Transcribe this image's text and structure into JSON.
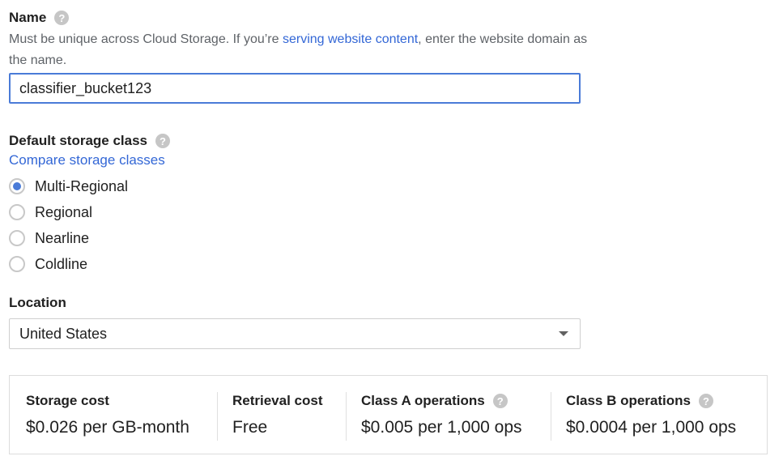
{
  "name": {
    "label": "Name",
    "help_icon": "help-circle-icon",
    "desc_before": "Must be unique across Cloud Storage. If you’re ",
    "desc_link": "serving website content",
    "desc_after": ", enter the website domain as the name.",
    "value": "classifier_bucket123"
  },
  "storage": {
    "label": "Default storage class",
    "help_icon": "help-circle-icon",
    "compare_link": "Compare storage classes",
    "options": [
      {
        "label": "Multi-Regional",
        "selected": true
      },
      {
        "label": "Regional",
        "selected": false
      },
      {
        "label": "Nearline",
        "selected": false
      },
      {
        "label": "Coldline",
        "selected": false
      }
    ]
  },
  "location": {
    "label": "Location",
    "value": "United States"
  },
  "costs": [
    {
      "title": "Storage cost",
      "value": "$0.026 per GB-month",
      "help": false
    },
    {
      "title": "Retrieval cost",
      "value": "Free",
      "help": false
    },
    {
      "title": "Class A operations",
      "value": "$0.005 per 1,000 ops",
      "help": true
    },
    {
      "title": "Class B operations",
      "value": "$0.0004 per 1,000 ops",
      "help": true
    }
  ],
  "colors": {
    "link": "#3367d6",
    "focus_border": "#4a7bd8",
    "radio_selected": "#4a7bd8",
    "help_icon": "#c6c6c6"
  }
}
